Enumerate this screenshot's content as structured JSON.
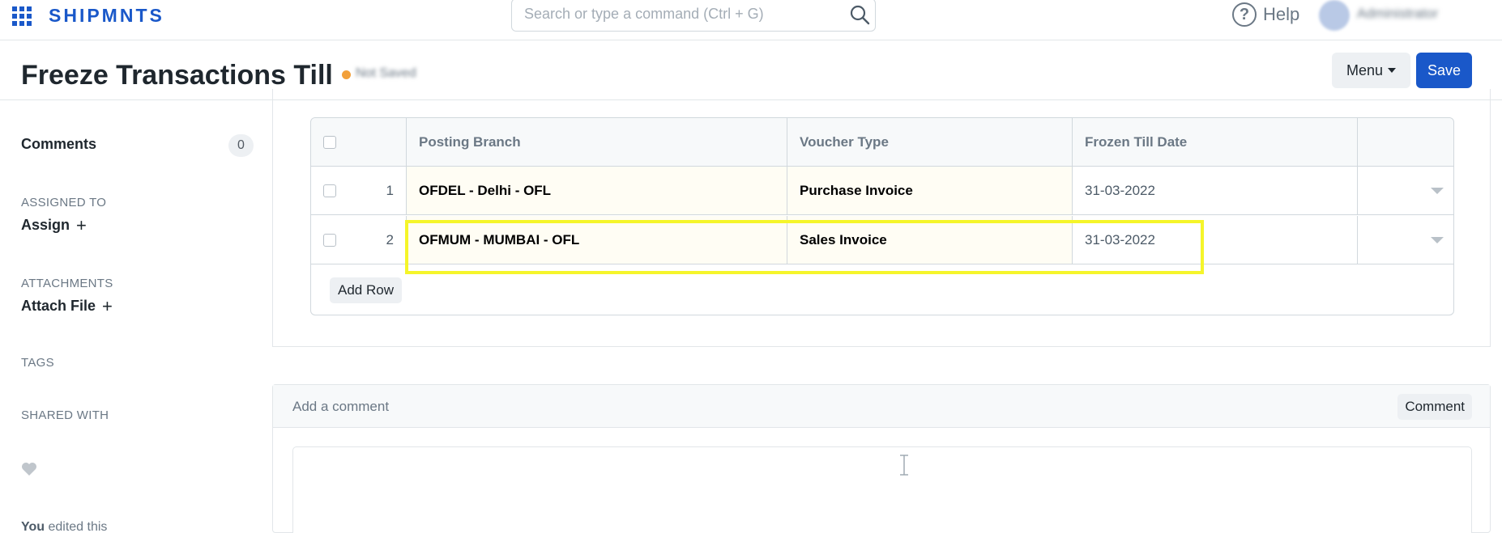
{
  "navbar": {
    "brand": "SHIPMNTS",
    "search_placeholder": "Search or type a command (Ctrl + G)",
    "help_label": "Help",
    "user_name": "Administrator"
  },
  "page": {
    "title": "Freeze Transactions Till",
    "status": "Not Saved",
    "menu_label": "Menu",
    "save_label": "Save"
  },
  "sidebar": {
    "comments_label": "Comments",
    "comments_count": "0",
    "assigned_heading": "ASSIGNED TO",
    "assign_label": "Assign",
    "attachments_heading": "ATTACHMENTS",
    "attach_label": "Attach File",
    "tags_heading": "TAGS",
    "shared_heading": "SHARED WITH",
    "activity_user": "You",
    "activity_text": "edited this"
  },
  "table": {
    "columns": [
      "Posting Branch",
      "Voucher Type",
      "Frozen Till Date"
    ],
    "rows": [
      {
        "idx": "1",
        "branch": "OFDEL - Delhi - OFL",
        "voucher": "Purchase Invoice",
        "date": "31-03-2022"
      },
      {
        "idx": "2",
        "branch": "OFMUM - MUMBAI - OFL",
        "voucher": "Sales Invoice",
        "date": "31-03-2022"
      }
    ],
    "add_row_label": "Add Row"
  },
  "comment": {
    "placeholder": "Add a comment",
    "button_label": "Comment"
  },
  "colors": {
    "brand": "#1a58c9",
    "status_dot": "#f2a03a",
    "highlight": "#f5f52a"
  }
}
